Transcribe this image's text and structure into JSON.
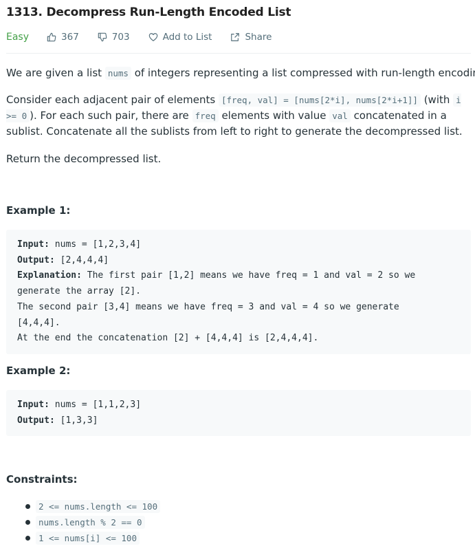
{
  "problem": {
    "title": "1313. Decompress Run-Length Encoded List",
    "difficulty": "Easy",
    "likes": "367",
    "dislikes": "703",
    "add_to_list_label": "Add to List",
    "share_label": "Share"
  },
  "description": {
    "p1": {
      "pre": "We are given a list ",
      "code1": "nums",
      "post": " of integers representing a list compressed with run-length encoding."
    },
    "p2": {
      "pre": "Consider each adjacent pair of elements ",
      "code1": "[freq, val] = [nums[2*i], nums[2*i+1]]",
      "mid1": " (with ",
      "code2": "i >= 0",
      "mid2": "). For each such pair, there are ",
      "code3": "freq",
      "mid3": " elements with value ",
      "code4": "val",
      "post": " concatenated in a sublist. Concatenate all the sublists from left to right to generate the decompressed list."
    },
    "p3": "Return the decompressed list."
  },
  "example1": {
    "heading": "Example 1:",
    "input_label": "Input:",
    "input_value": " nums = [1,2,3,4]",
    "output_label": "Output:",
    "output_value": " [2,4,4,4]",
    "explanation_label": "Explanation:",
    "explanation_line1": " The first pair [1,2] means we have freq = 1 and val = 2 so we",
    "explanation_line2": "generate the array [2].",
    "explanation_line3": "The second pair [3,4] means we have freq = 3 and val = 4 so we generate",
    "explanation_line4": "[4,4,4].",
    "explanation_line5": "At the end the concatenation [2] + [4,4,4] is [2,4,4,4]."
  },
  "example2": {
    "heading": "Example 2:",
    "input_label": "Input:",
    "input_value": " nums = [1,1,2,3]",
    "output_label": "Output:",
    "output_value": " [1,3,3]"
  },
  "constraints": {
    "heading": "Constraints:",
    "items": [
      "2 <= nums.length <= 100",
      "nums.length % 2 == 0",
      "1 <= nums[i] <= 100"
    ]
  },
  "icons": {
    "like": "thumbs-up-icon",
    "dislike": "thumbs-down-icon",
    "add_to_list": "heart-icon",
    "share": "share-icon"
  },
  "colors": {
    "easy": "#43a047",
    "code_background": "#f7f9fa",
    "text": "#263238",
    "muted": "#546e7a"
  }
}
